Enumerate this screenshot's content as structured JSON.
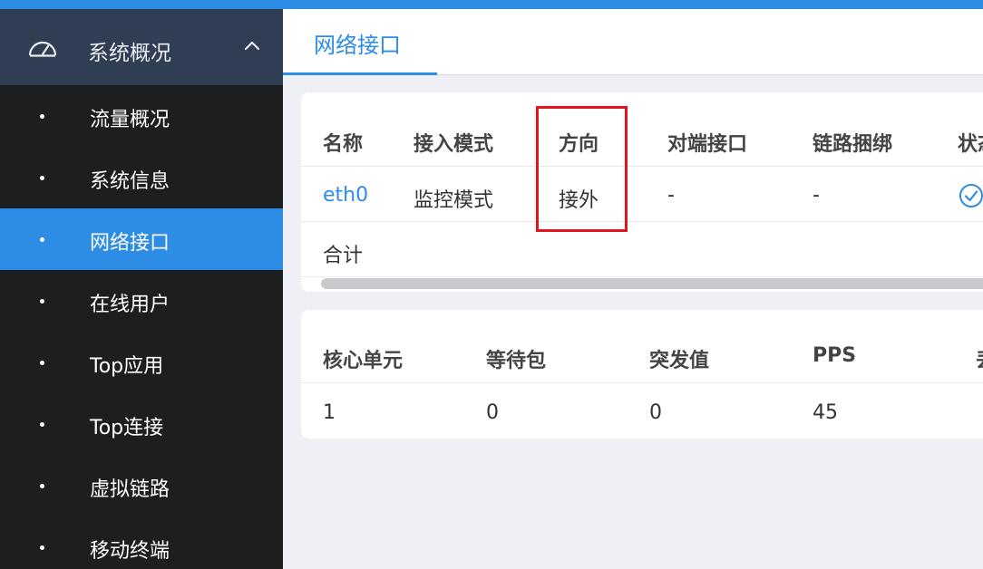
{
  "sidebar": {
    "section_title": "系统概况",
    "items": [
      {
        "label": "流量概况",
        "active": false
      },
      {
        "label": "系统信息",
        "active": false
      },
      {
        "label": "网络接口",
        "active": true
      },
      {
        "label": "在线用户",
        "active": false
      },
      {
        "label": "Top应用",
        "active": false
      },
      {
        "label": "Top连接",
        "active": false
      },
      {
        "label": "虚拟链路",
        "active": false
      },
      {
        "label": "移动终端",
        "active": false
      }
    ]
  },
  "tab": {
    "label": "网络接口"
  },
  "interfaces_table": {
    "headers": [
      "名称",
      "接入模式",
      "方向",
      "对端接口",
      "链路捆绑",
      "状态"
    ],
    "rows": [
      {
        "name": "eth0",
        "mode": "监控模式",
        "direction": "接外",
        "peer": "-",
        "bond": "-",
        "status": "ok"
      }
    ],
    "total_label": "合计"
  },
  "stats_table": {
    "headers": [
      "核心单元",
      "等待包",
      "突发值",
      "PPS",
      "丢"
    ],
    "rows": [
      [
        "1",
        "0",
        "0",
        "45"
      ]
    ]
  },
  "colors": {
    "accent": "#2d8ce3",
    "sidebar_bg": "#1d1e20",
    "sidebar_head_bg": "#2f3e52",
    "highlight": "#e3141b"
  }
}
